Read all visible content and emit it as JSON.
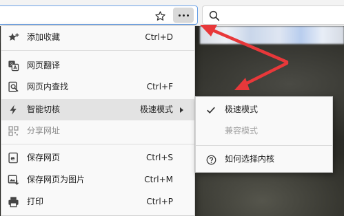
{
  "colors": {
    "accent_border": "#6aa1e6",
    "menu_bg": "#f9f9f9",
    "hover_bg": "#e3e3e3",
    "annotation_arrow": "#e8383a"
  },
  "toolbar": {
    "favorite_icon": "star-icon",
    "more_icon": "more-horizontal-icon",
    "search_icon": "search-icon"
  },
  "menu": {
    "items": [
      {
        "label": "添加收藏",
        "shortcut": "Ctrl+D",
        "icon": "add-favorite-icon"
      },
      {
        "label": "网页翻译",
        "shortcut": "",
        "icon": "translate-icon"
      },
      {
        "label": "网页内查找",
        "shortcut": "Ctrl+F",
        "icon": "find-in-page-icon"
      },
      {
        "label": "智能切核",
        "submenu_value": "极速模式",
        "icon": "lightning-icon"
      },
      {
        "label": "分享网址",
        "shortcut": "",
        "icon": "share-qr-icon"
      },
      {
        "label": "保存网页",
        "shortcut": "Ctrl+S",
        "icon": "save-page-icon"
      },
      {
        "label": "保存网页为图片",
        "shortcut": "Ctrl+M",
        "icon": "save-image-icon"
      },
      {
        "label": "打印",
        "shortcut": "Ctrl+P",
        "icon": "printer-icon"
      }
    ]
  },
  "submenu": {
    "items": [
      {
        "label": "极速模式",
        "icon": "check-icon"
      },
      {
        "label": "兼容模式",
        "icon": ""
      },
      {
        "label": "如何选择内核",
        "icon": "help-circle-icon"
      }
    ]
  }
}
